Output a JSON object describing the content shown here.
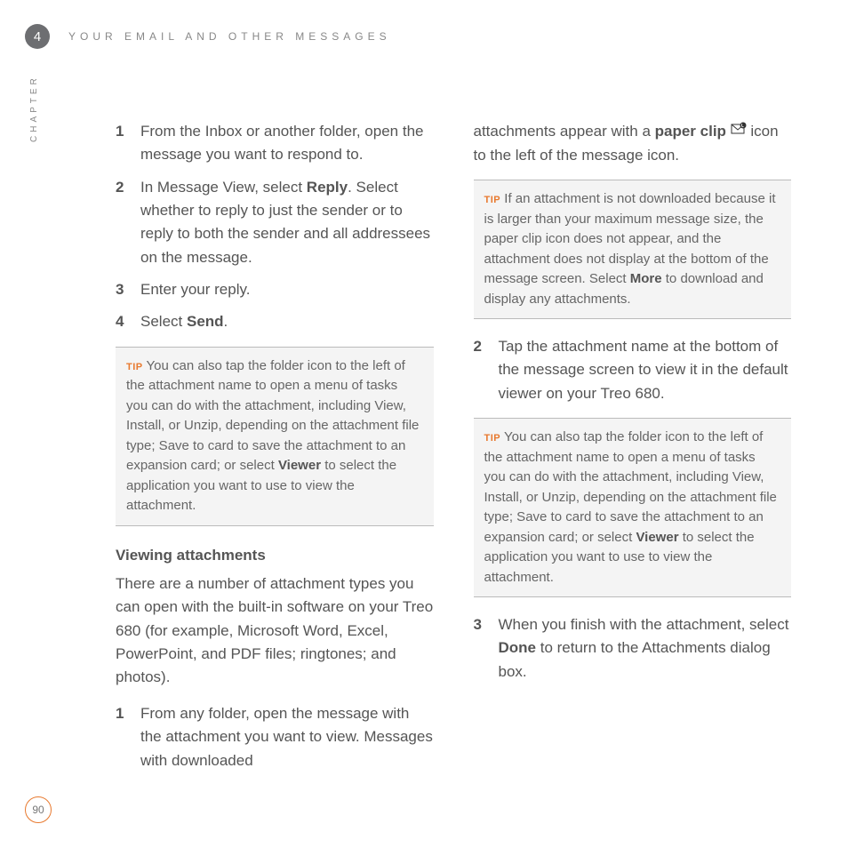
{
  "chapter": {
    "number": "4",
    "title": "YOUR EMAIL AND OTHER MESSAGES",
    "sidebar": "CHAPTER"
  },
  "left": {
    "steps": [
      {
        "num": "1",
        "text": "From the Inbox or another folder, open the message you want to respond to."
      },
      {
        "num": "2",
        "pre": "In Message View, select ",
        "bold1": "Reply",
        "post": ". Select whether to reply to just the sender or to reply to both the sender and all addressees on the message."
      },
      {
        "num": "3",
        "text": "Enter your reply."
      },
      {
        "num": "4",
        "pre": "Select ",
        "bold1": "Send",
        "post": "."
      }
    ],
    "tip": {
      "label": "TIP",
      "pre": "You can also tap the folder icon to the left of the attachment name to open a menu of tasks you can do with the attachment, including View, Install, or Unzip, depending on the attachment file type; Save to card to save the attachment to an expansion card; or select ",
      "bold": "Viewer",
      "post": " to select the application you want to use to view the attachment."
    },
    "subhead": "Viewing attachments",
    "intro": "There are a number of attachment types you can open with the built-in software on your Treo 680 (for example, Microsoft Word, Excel, PowerPoint, and PDF files; ringtones; and photos).",
    "step1": {
      "num": "1",
      "text": "From any folder, open the message with the attachment you want to view. Messages with downloaded"
    }
  },
  "right": {
    "cont": {
      "pre": "attachments appear with a ",
      "bold": "paper clip",
      "post": " icon to the left of the message icon."
    },
    "tip1": {
      "label": "TIP",
      "pre": "If an attachment is not downloaded because it is larger than your maximum message size, the paper clip icon does not appear, and the attachment does not display at the bottom of the message screen. Select ",
      "bold": "More",
      "post": " to download and display any attachments."
    },
    "step2": {
      "num": "2",
      "text": "Tap the attachment name at the bottom of the message screen to view it in the default viewer on your Treo 680."
    },
    "tip2": {
      "label": "TIP",
      "pre": "You can also tap the folder icon to the left of the attachment name to open a menu of tasks you can do with the attachment, including View, Install, or Unzip, depending on the attachment file type; Save to card to save the attachment to an expansion card; or select ",
      "bold": "Viewer",
      "post": " to select the application you want to use to view the attachment."
    },
    "step3": {
      "num": "3",
      "pre": "When you finish with the attachment, select ",
      "bold": "Done",
      "post": " to return to the Attachments dialog box."
    }
  },
  "pageNumber": "90"
}
